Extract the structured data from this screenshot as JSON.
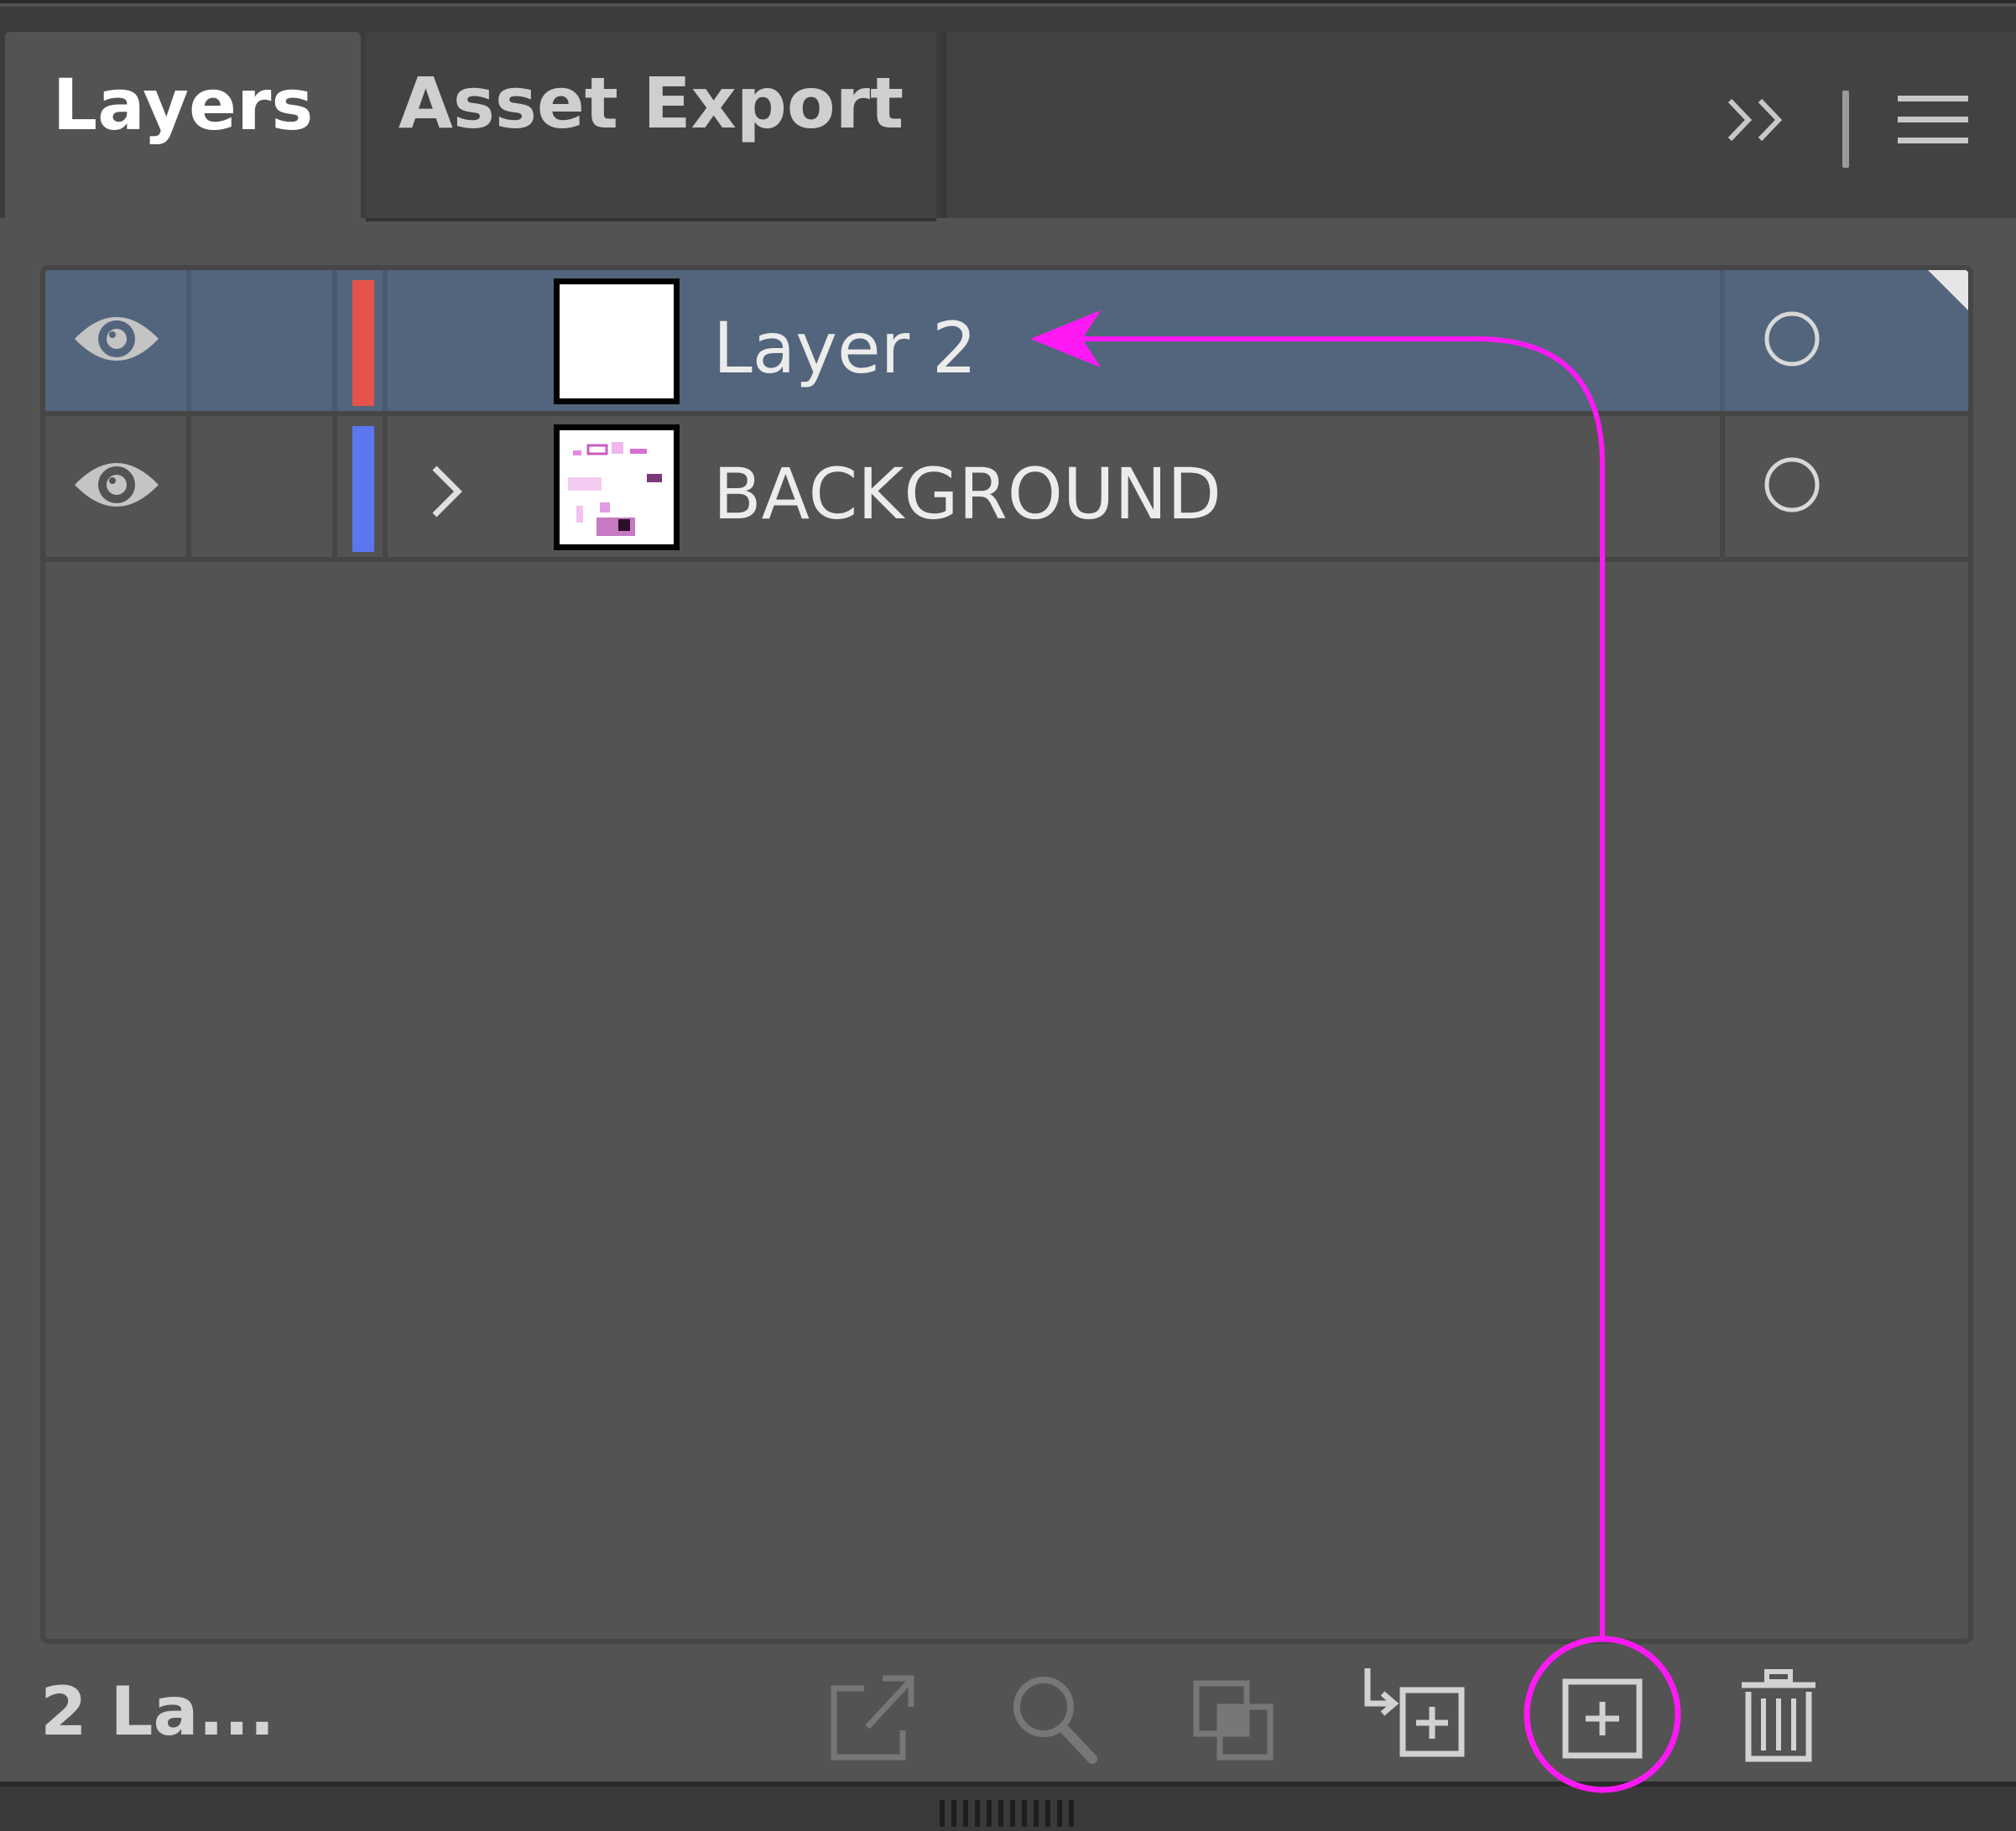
{
  "tabs": [
    {
      "label": "Layers",
      "active": true
    },
    {
      "label": "Asset Export",
      "active": false
    }
  ],
  "layers": [
    {
      "name": "Layer 2",
      "color": "#e5534b",
      "selected": true,
      "expandable": false
    },
    {
      "name": "BACKGROUND",
      "color": "#5b78f0",
      "selected": false,
      "expandable": true
    }
  ],
  "footer": {
    "count_label": "2 La..."
  },
  "annotation": {
    "color": "#ff19f5"
  }
}
